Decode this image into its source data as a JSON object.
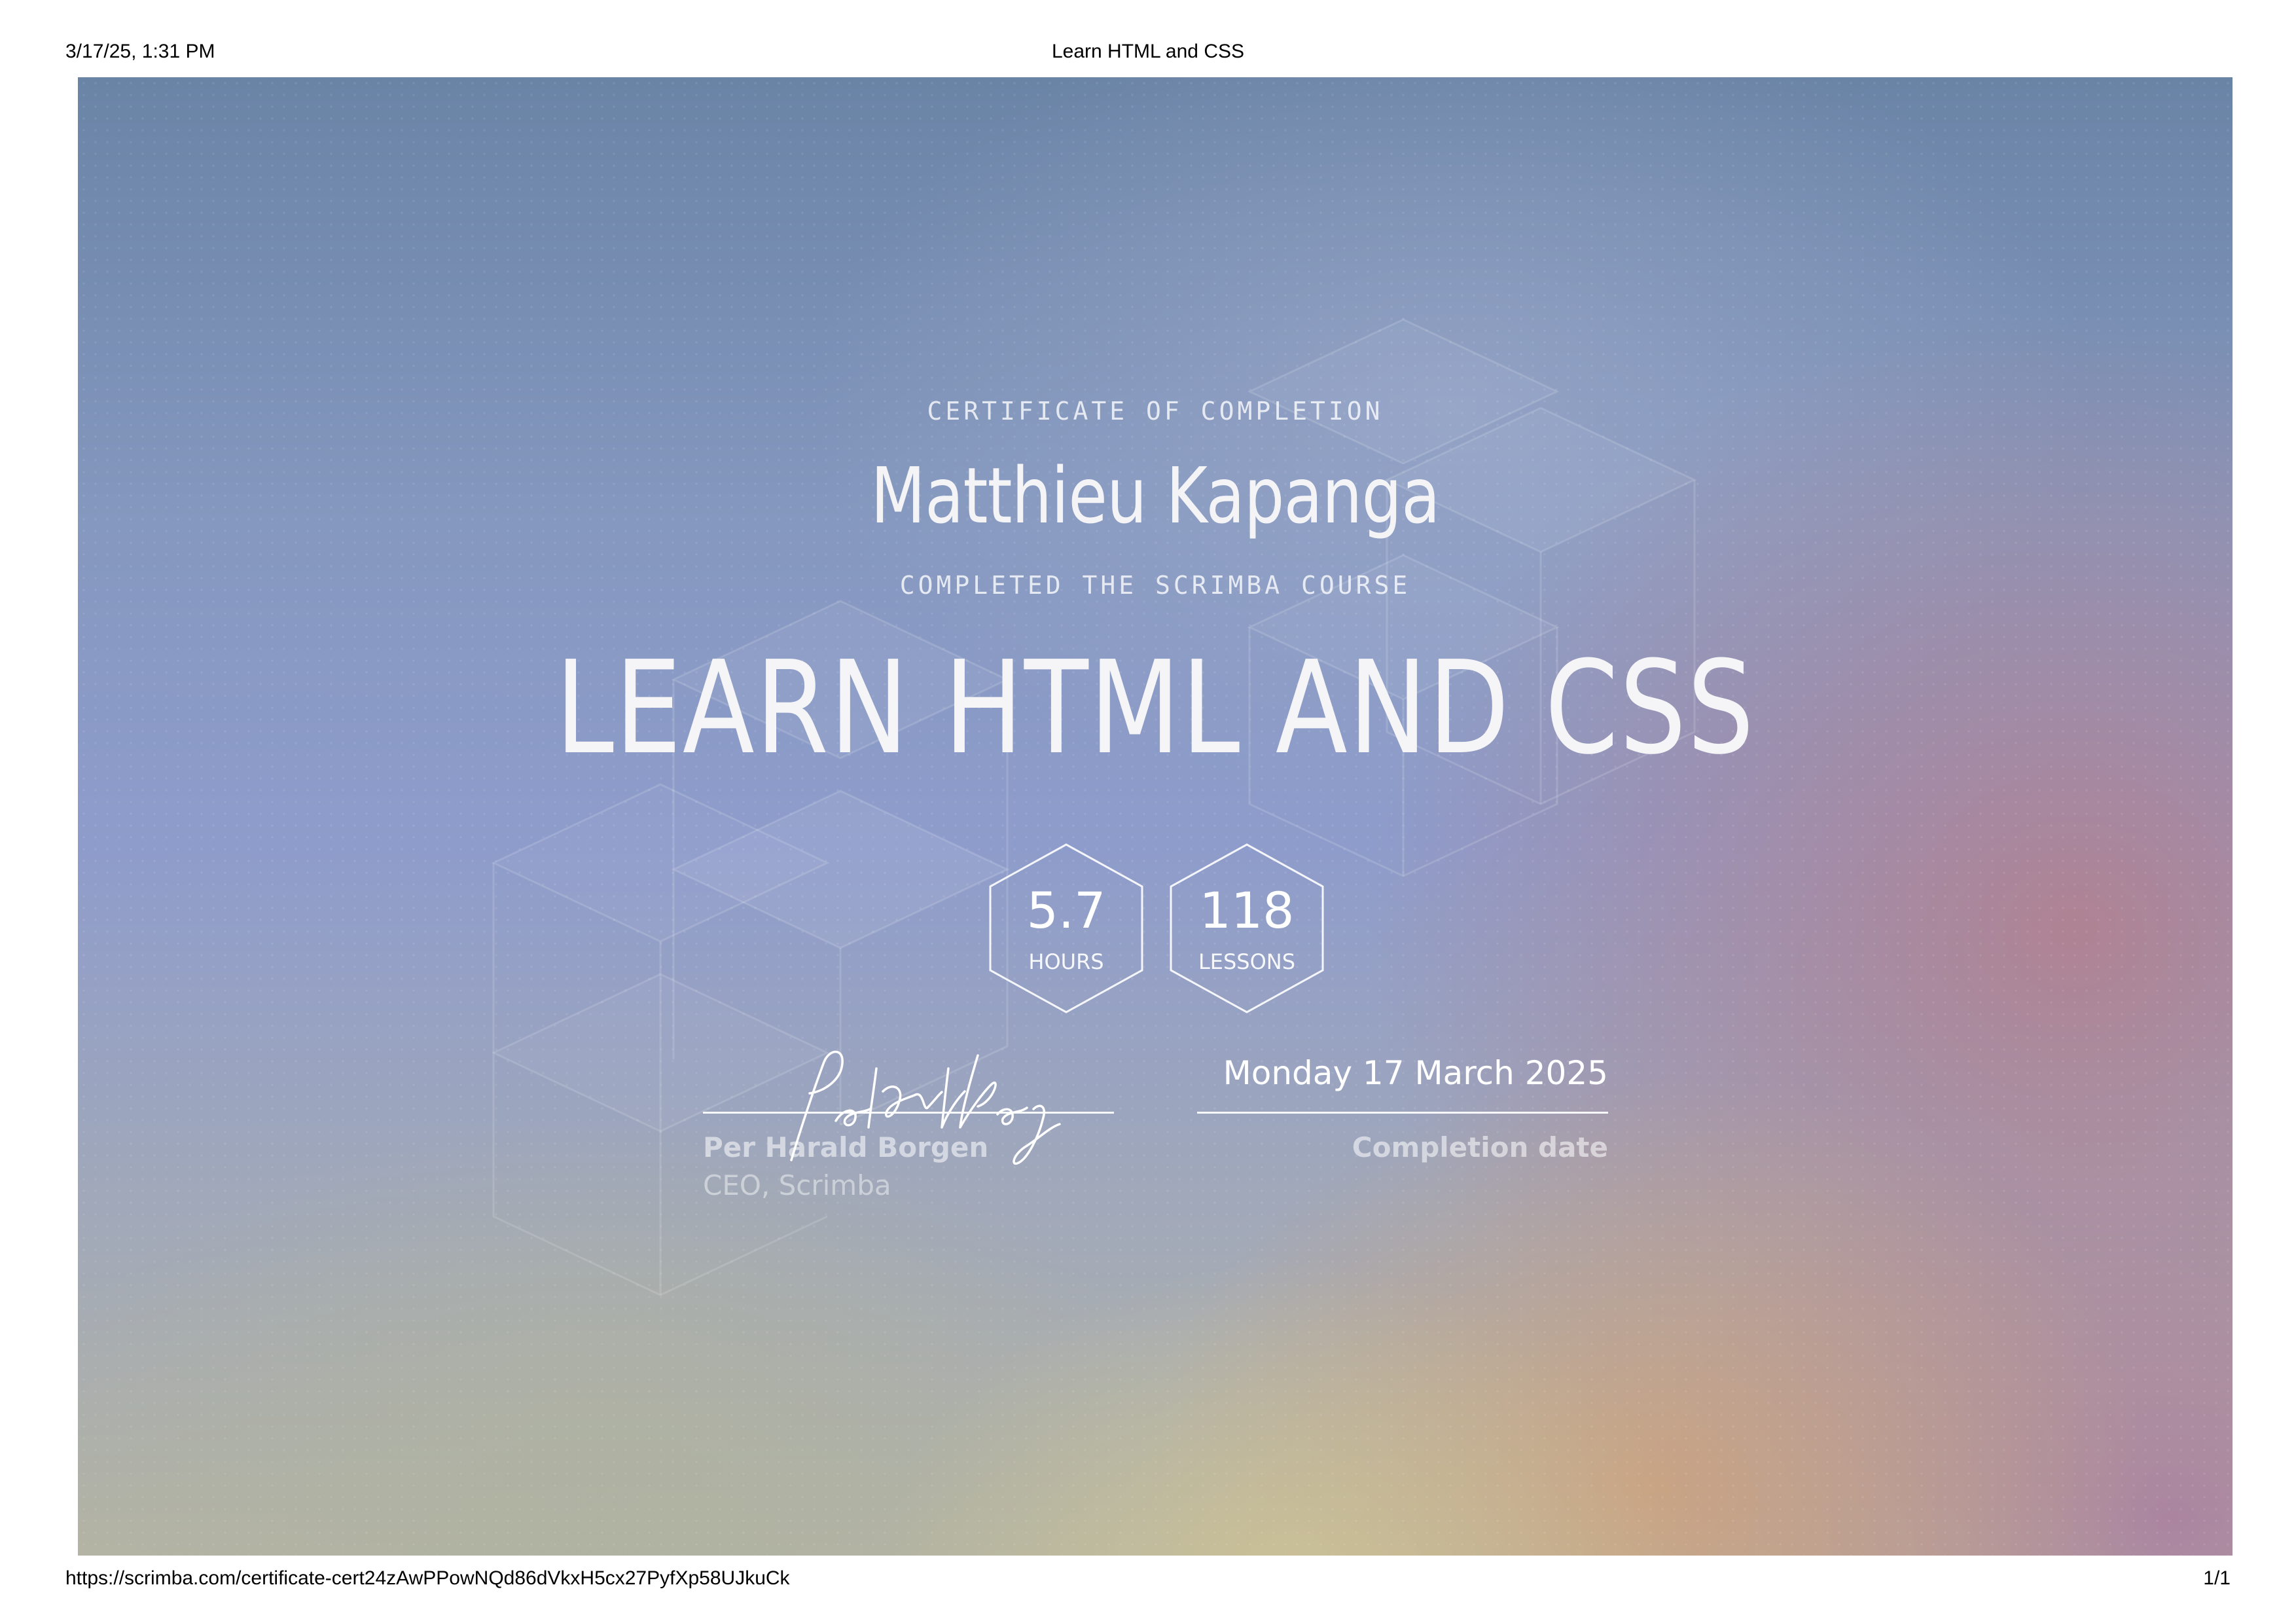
{
  "print_header": {
    "datetime": "3/17/25, 1:31 PM",
    "page_title": "Learn HTML and CSS"
  },
  "print_footer": {
    "url": "https://scrimba.com/certificate-cert24zAwPPowNQd86dVkxH5cx27PyfXp58UJkuCk",
    "page_number": "1/1"
  },
  "certificate": {
    "eyebrow": "CERTIFICATE OF COMPLETION",
    "recipient": "Matthieu Kapanga",
    "subheading": "COMPLETED THE SCRIMBA COURSE",
    "course_title": "LEARN HTML AND CSS",
    "stats": [
      {
        "value": "5.7",
        "unit": "HOURS"
      },
      {
        "value": "118",
        "unit": "LESSONS"
      }
    ],
    "signer_name": "Per Harald Borgen",
    "signer_role": "CEO, Scrimba",
    "completion_date": "Monday 17 March 2025",
    "completion_label": "Completion date"
  },
  "colors": {
    "top_background": "#6a84a6",
    "mid_background": "#8e9ccb",
    "warm_right": "#b2808e",
    "warm_bottom": "#cda07d",
    "yellow_bottom": "#cdc396",
    "text": "#ffffff"
  }
}
